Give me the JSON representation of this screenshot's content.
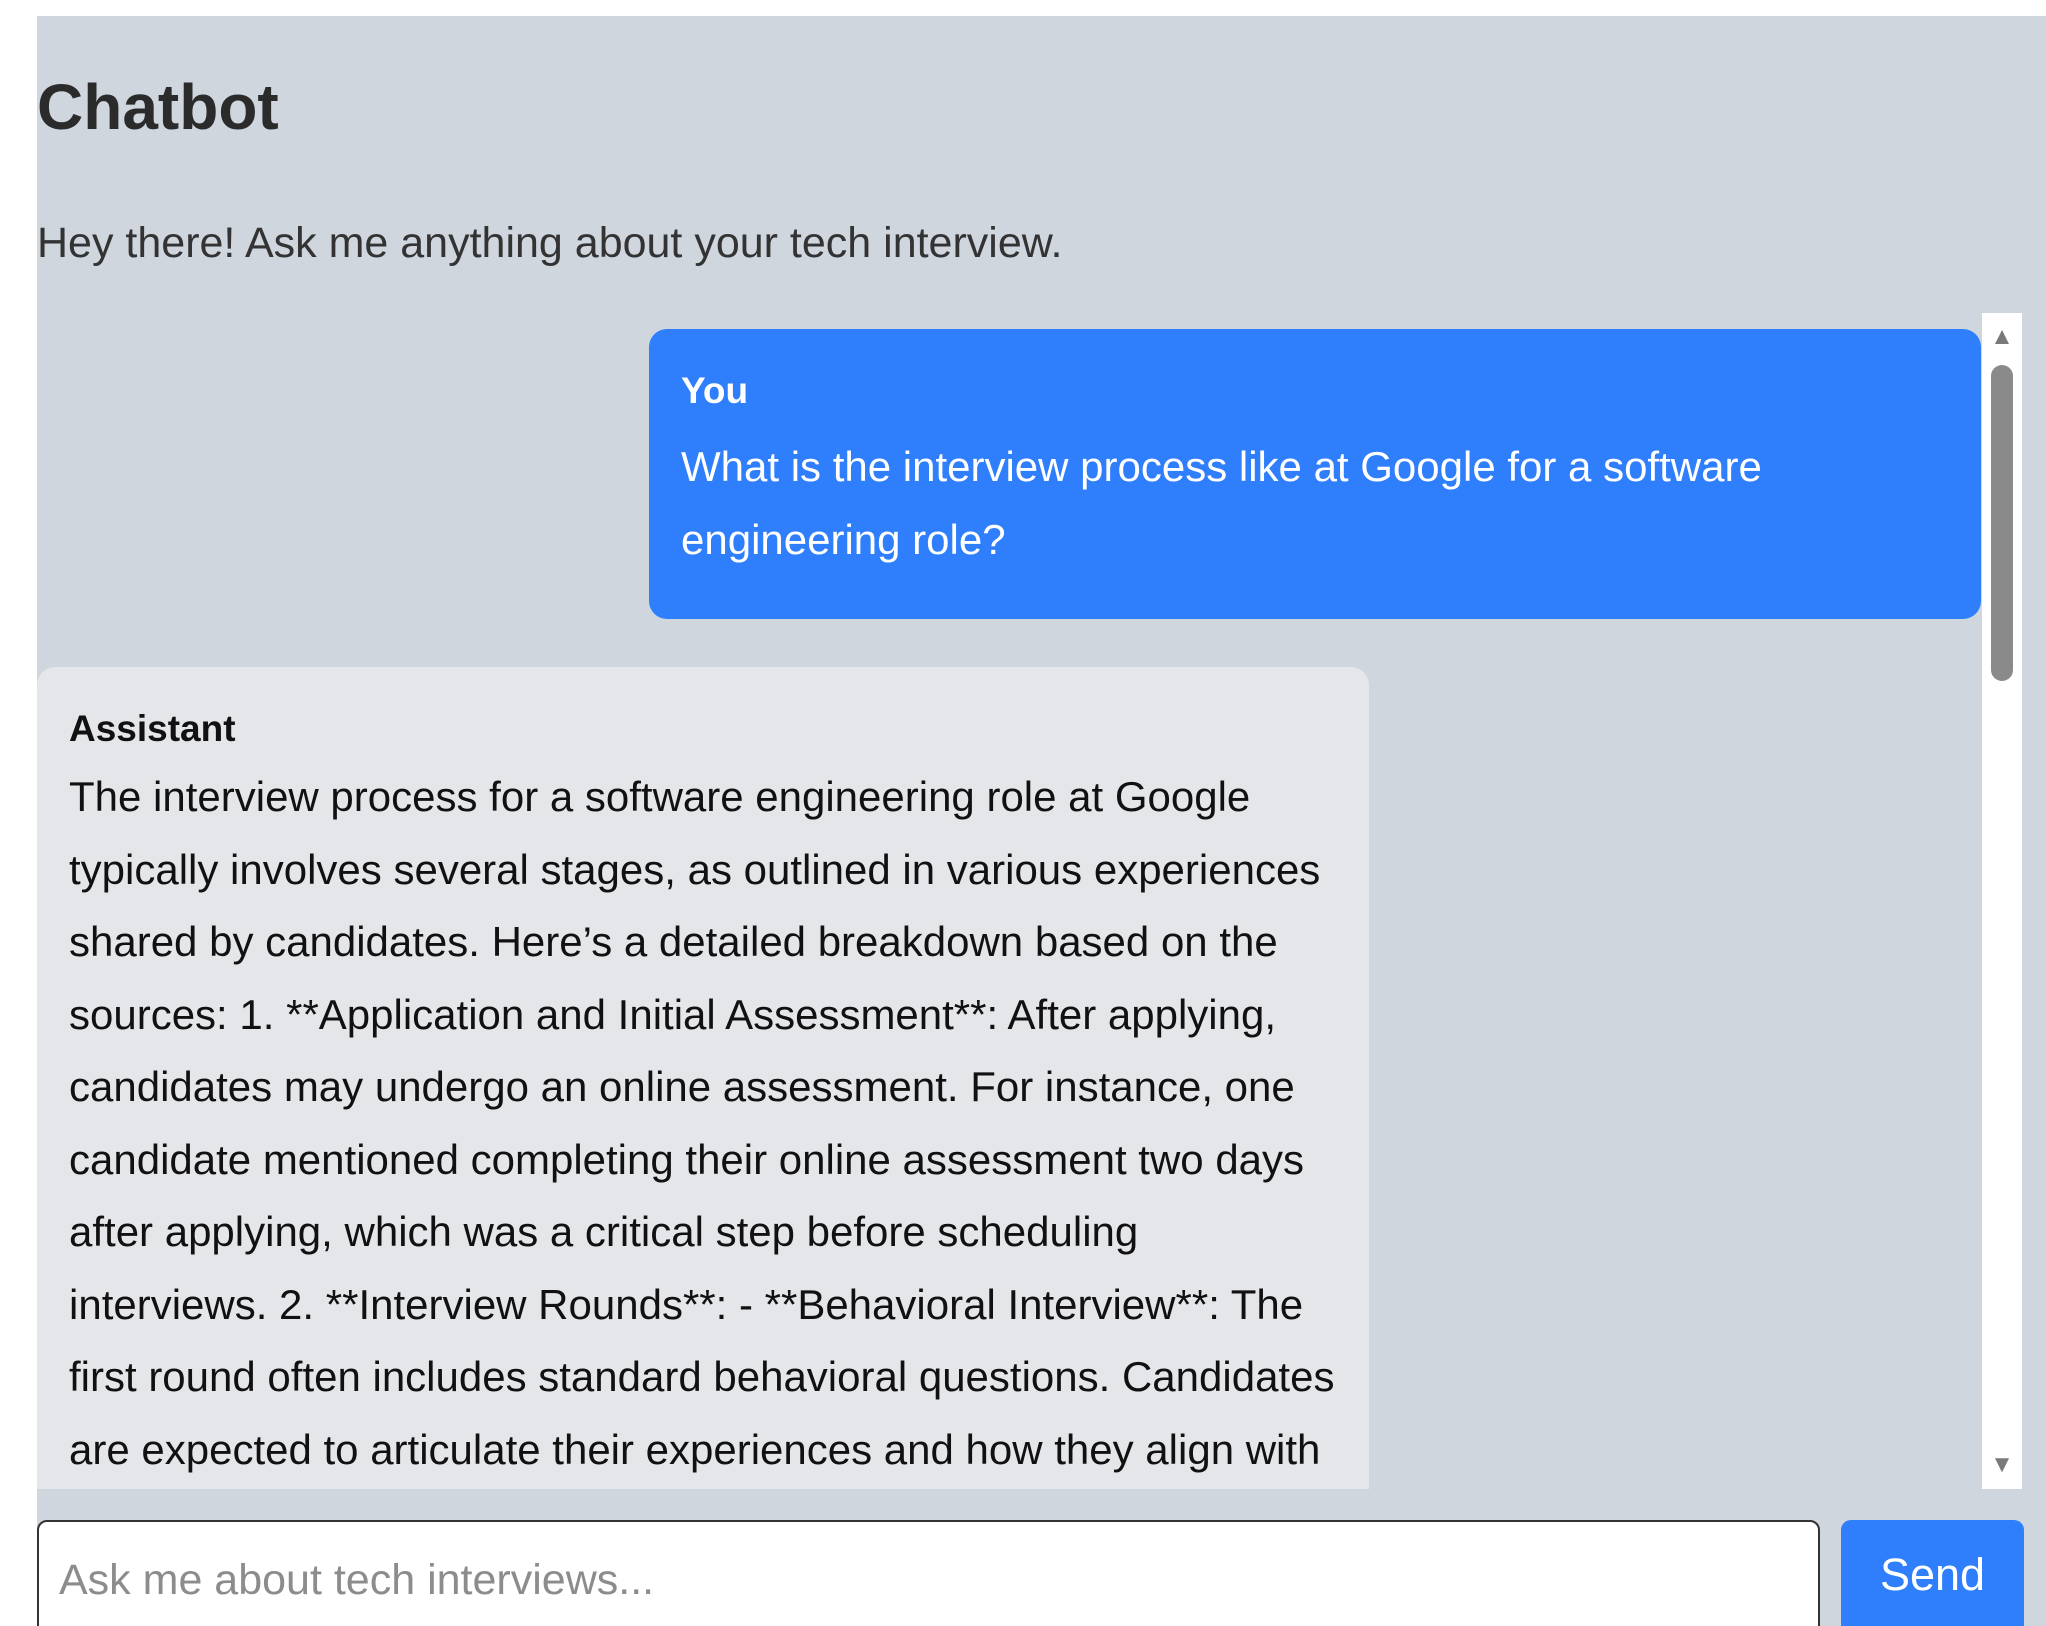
{
  "header": {
    "title": "Chatbot",
    "subtitle": "Hey there! Ask me anything about your tech interview."
  },
  "messages": [
    {
      "author": "You",
      "text": "What is the interview process like at Google for a software engineering role?"
    },
    {
      "author": "Assistant",
      "text": "The interview process for a software engineering role at Google typically involves several stages, as outlined in various experiences shared by candidates. Here’s a detailed breakdown based on the sources: 1. **Application and Initial Assessment**: After applying, candidates may undergo an online assessment. For instance, one candidate mentioned completing their online assessment two days after applying, which was a critical step before scheduling interviews. 2. **Interview Rounds**: - **Behavioral Interview**: The first round often includes standard behavioral questions. Candidates are expected to articulate their experiences and how they align with"
    }
  ],
  "scrollbar": {
    "up_icon": "triangle-up-icon",
    "down_icon": "triangle-down-icon"
  },
  "composer": {
    "placeholder": "Ask me about tech interviews...",
    "value": "",
    "send_label": "Send"
  },
  "colors": {
    "background": "#cfd6dd",
    "user_bubble": "#2f7ffd",
    "assistant_bubble": "#e4e6ea",
    "send_button": "#2f7ffd"
  }
}
